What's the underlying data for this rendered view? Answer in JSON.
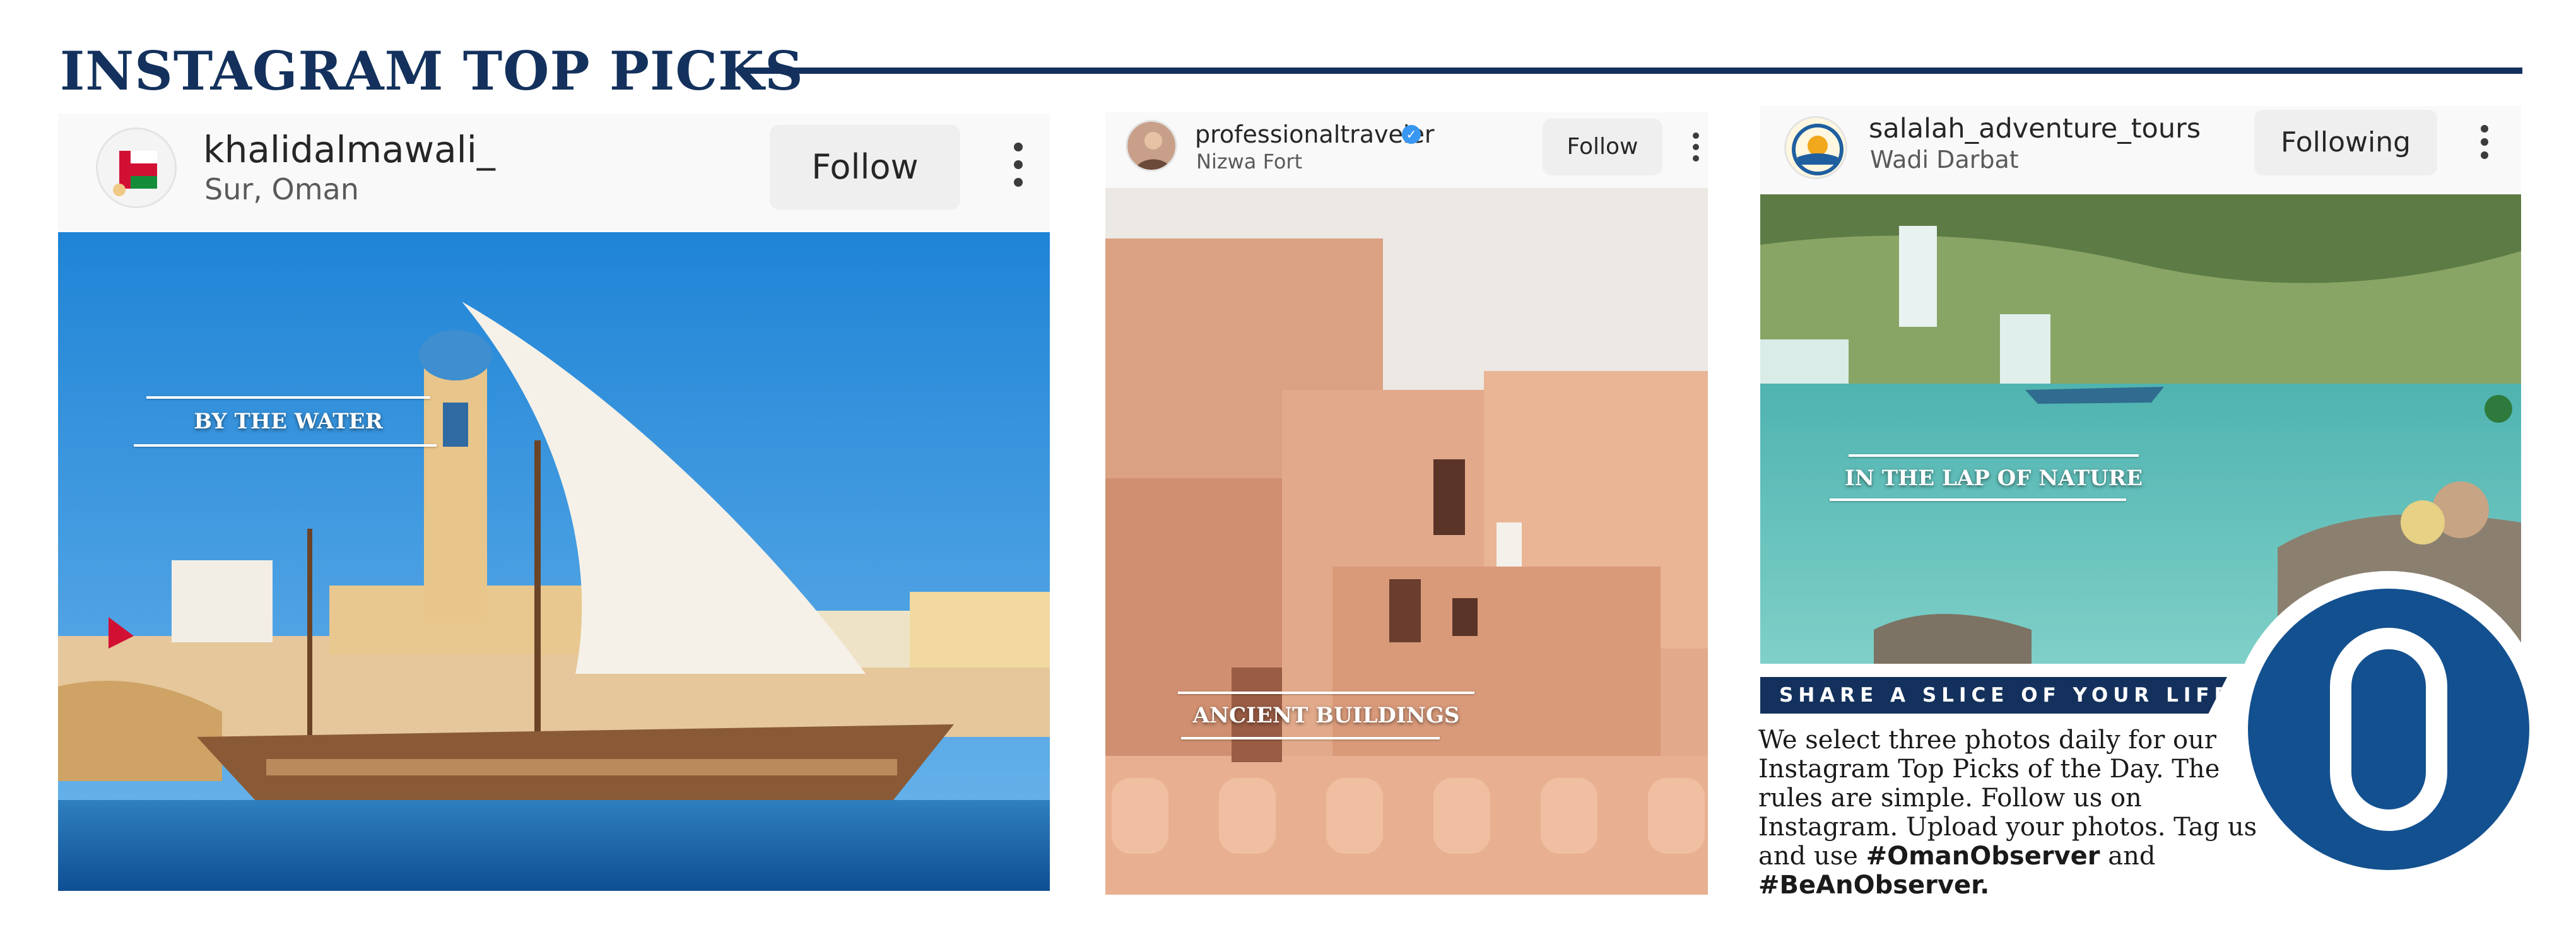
{
  "header": {
    "title": "INSTAGRAM TOP PICKS"
  },
  "posts": [
    {
      "username": "khalidalmawali_",
      "location": "Sur, Oman",
      "follow_label": "Follow",
      "caption": "BY THE WATER",
      "verified": false
    },
    {
      "username": "professionaltraveler",
      "location": "Nizwa Fort",
      "follow_label": "Follow",
      "caption": "ANCIENT BUILDINGS",
      "verified": true
    },
    {
      "username": "salalah_adventure_tours",
      "location": "Wadi Darbat",
      "follow_label": "Following",
      "caption": "IN THE LAP OF NATURE",
      "verified": false
    }
  ],
  "panel": {
    "banner": "SHARE A SLICE OF YOUR LIFE",
    "body": "We select three photos daily for our Instagram Top Picks of the Day. The rules are simple. Follow us on Instagram. Upload your photos. Tag us and use",
    "hashtag1": "#OmanObserver",
    "conjunction": "and",
    "hashtag2": "#BeAnObserver."
  },
  "colors": {
    "navy": "#13315c",
    "logo_blue": "#13508f",
    "verified_blue": "#3897f0"
  },
  "icons": [
    "more-options-icon",
    "verified-badge-icon",
    "oman-flag-icon",
    "observer-logo-icon"
  ]
}
